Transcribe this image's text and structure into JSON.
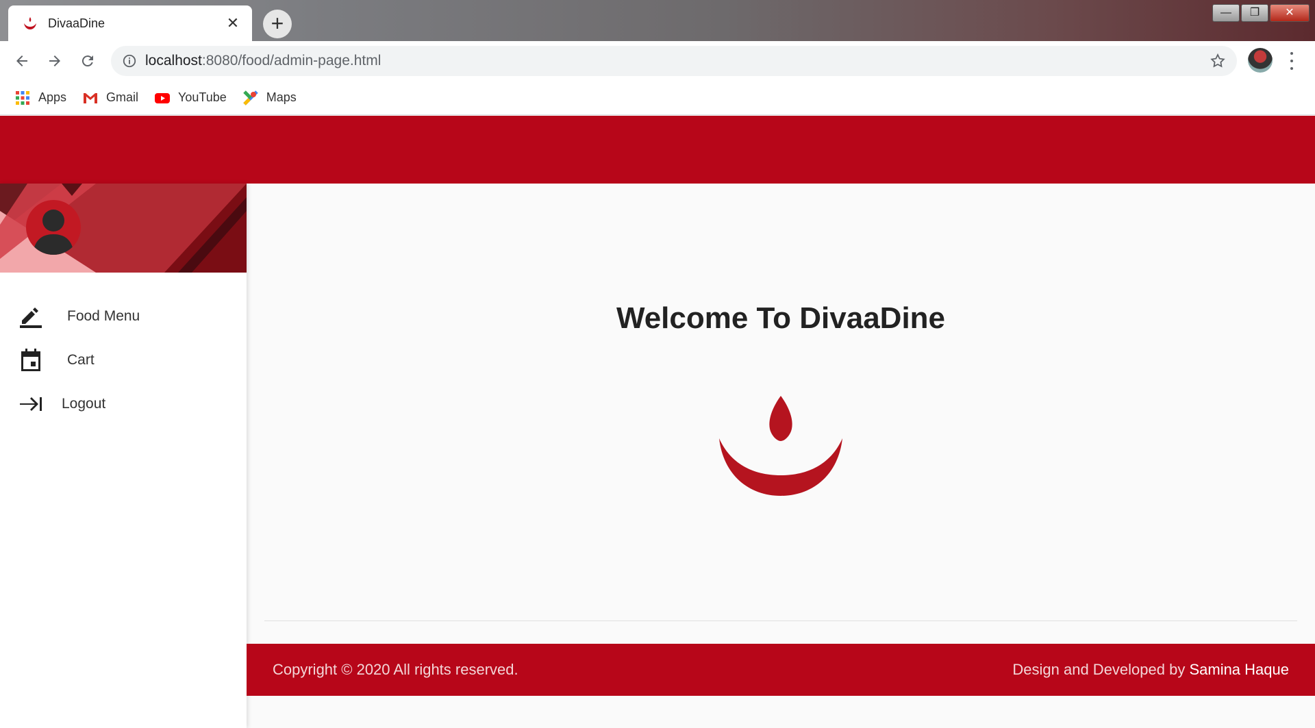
{
  "browser": {
    "tab_title": "DivaaDine",
    "tab_close": "✕",
    "new_tab": "+",
    "url_host": "localhost",
    "url_rest": ":8080/food/admin-page.html",
    "bookmarks": [
      {
        "label": "Apps",
        "icon": "apps-grid-icon"
      },
      {
        "label": "Gmail",
        "icon": "gmail-icon"
      },
      {
        "label": "YouTube",
        "icon": "youtube-icon"
      },
      {
        "label": "Maps",
        "icon": "maps-icon"
      }
    ],
    "window_buttons": [
      "—",
      "❐",
      "✕"
    ]
  },
  "sidebar": {
    "items": [
      {
        "label": "Food Menu",
        "icon": "edit-pencil-icon"
      },
      {
        "label": "Cart",
        "icon": "calendar-icon"
      },
      {
        "label": "Logout",
        "icon": "logout-arrow-icon"
      }
    ]
  },
  "main": {
    "welcome": "Welcome To DivaaDine"
  },
  "footer": {
    "copyright": "Copyright © 2020 All rights reserved.",
    "credit_prefix": "Design and Developed by ",
    "credit_author": "Samina Haque"
  },
  "colors": {
    "brand_red": "#b70619",
    "text_dark": "#222222"
  }
}
